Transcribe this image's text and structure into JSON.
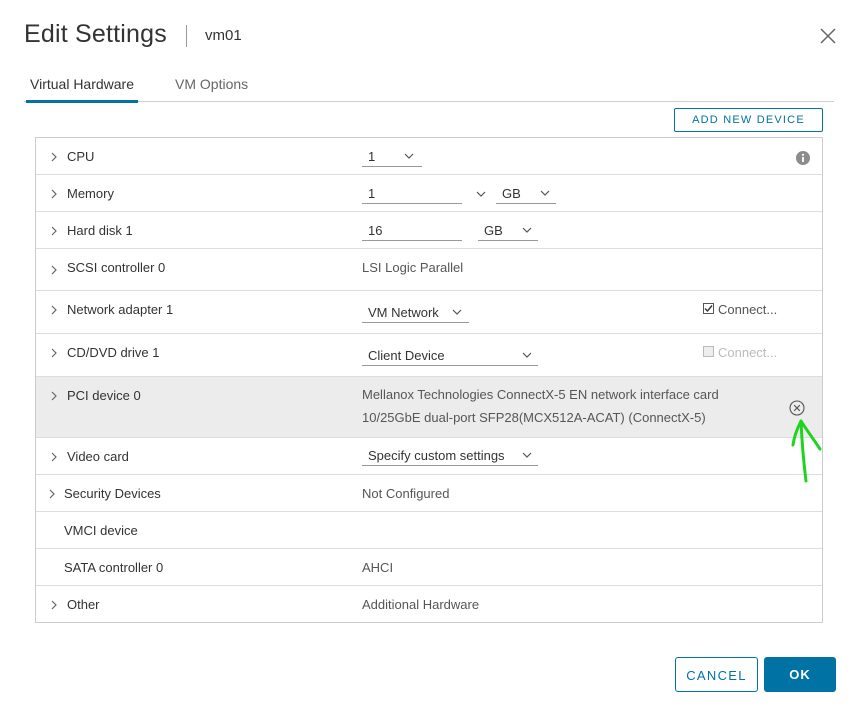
{
  "dialog": {
    "title": "Edit Settings",
    "vm_name": "vm01"
  },
  "tabs": [
    {
      "label": "Virtual Hardware",
      "active": true
    },
    {
      "label": "VM Options",
      "active": false
    }
  ],
  "toolbar": {
    "add_new_device_label": "ADD NEW DEVICE"
  },
  "hardware": {
    "cpu": {
      "label": "CPU",
      "value": "1"
    },
    "memory": {
      "label": "Memory",
      "value": "1",
      "unit": "GB"
    },
    "hard_disk": {
      "label": "Hard disk 1",
      "value": "16",
      "unit": "GB"
    },
    "scsi": {
      "label": "SCSI controller 0",
      "value": "LSI Logic Parallel"
    },
    "network": {
      "label": "Network adapter 1",
      "value": "VM Network",
      "connect_label": "Connect...",
      "connected": true
    },
    "cdrom": {
      "label": "CD/DVD drive 1",
      "value": "Client Device",
      "connect_label": "Connect...",
      "connected": false
    },
    "pci": {
      "label": "PCI device 0",
      "value_line1": "Mellanox Technologies ConnectX-5 EN network interface card",
      "value_line2": "10/25GbE dual-port SFP28(MCX512A-ACAT) (ConnectX-5)"
    },
    "video": {
      "label": "Video card",
      "value": "Specify custom settings"
    },
    "security": {
      "label": "Security Devices",
      "value": "Not Configured"
    },
    "vmci": {
      "label": "VMCI device"
    },
    "sata": {
      "label": "SATA controller 0",
      "value": "AHCI"
    },
    "other": {
      "label": "Other",
      "value": "Additional Hardware"
    }
  },
  "footer": {
    "cancel_label": "CANCEL",
    "ok_label": "OK"
  },
  "colors": {
    "accent": "#0072a3",
    "annotation": "#1fd41f",
    "pci_row_bg": "#ececec"
  }
}
